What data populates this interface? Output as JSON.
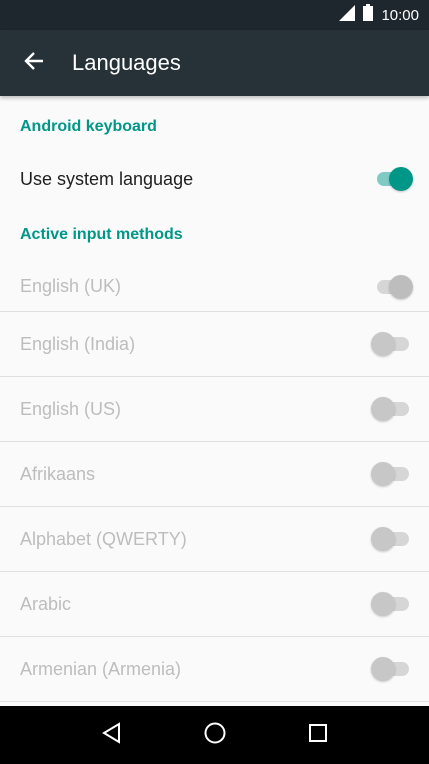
{
  "status_bar": {
    "time": "10:00"
  },
  "app_bar": {
    "title": "Languages"
  },
  "sections": [
    {
      "header": "Android keyboard",
      "items": [
        {
          "label": "Use system language",
          "checked": true,
          "enabled": true
        }
      ]
    },
    {
      "header": "Active input methods",
      "items": [
        {
          "label": "English (UK)",
          "checked": true,
          "enabled": false
        },
        {
          "label": "English (India)",
          "checked": false,
          "enabled": false
        },
        {
          "label": "English (US)",
          "checked": false,
          "enabled": false
        },
        {
          "label": "Afrikaans",
          "checked": false,
          "enabled": false
        },
        {
          "label": "Alphabet (QWERTY)",
          "checked": false,
          "enabled": false
        },
        {
          "label": "Arabic",
          "checked": false,
          "enabled": false
        },
        {
          "label": "Armenian (Armenia)",
          "checked": false,
          "enabled": false
        }
      ]
    }
  ],
  "colors": {
    "accent": "#009688",
    "app_bar": "#263238",
    "status_bar": "#1d272d"
  },
  "nav_icons": [
    "back-triangle-icon",
    "home-circle-icon",
    "recents-square-icon"
  ]
}
